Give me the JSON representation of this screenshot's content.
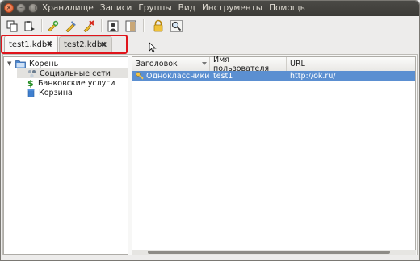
{
  "window": {
    "buttons": [
      "×",
      "–",
      "□"
    ]
  },
  "menubar": {
    "items": [
      "Хранилище",
      "Записи",
      "Группы",
      "Вид",
      "Инструменты",
      "Помощь"
    ]
  },
  "toolbar": {
    "icons": [
      "copy-icon",
      "paste-icon",
      "add-entry-icon",
      "edit-entry-icon",
      "delete-entry-icon",
      "copy-username-icon",
      "copy-password-icon",
      "lock-icon",
      "search-icon"
    ]
  },
  "tabs": [
    {
      "label": "test1.kdbx",
      "close": "✖",
      "active": true
    },
    {
      "label": "test2.kdbx",
      "close": "✖",
      "active": false
    }
  ],
  "tree": {
    "expander": "▼",
    "root": "Корень",
    "children": [
      "Социальные сети",
      "Банковские услуги",
      "Корзина"
    ]
  },
  "table": {
    "columns": [
      "Заголовок",
      "Имя пользователя",
      "URL"
    ],
    "rows": [
      {
        "title": "Одноклассники",
        "username": "test1",
        "url": "http://ok.ru/"
      }
    ]
  },
  "colors": {
    "selection": "#5b8fd1",
    "highlight_border": "#e0141b"
  }
}
